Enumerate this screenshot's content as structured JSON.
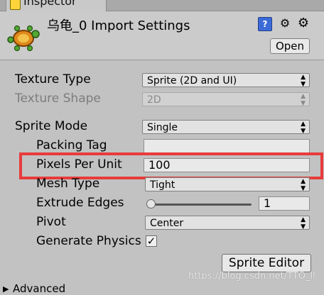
{
  "tab": {
    "label": "Inspector",
    "icon": "inspector-icon"
  },
  "header": {
    "title": "乌龟_0 Import Settings",
    "open_label": "Open",
    "help_icon": "?",
    "preset_icon": "⚙",
    "gear_icon": "⚙"
  },
  "fields": {
    "texture_type": {
      "label": "Texture Type",
      "value": "Sprite (2D and UI)"
    },
    "texture_shape": {
      "label": "Texture Shape",
      "value": "2D"
    },
    "sprite_mode": {
      "label": "Sprite Mode",
      "value": "Single"
    },
    "packing_tag": {
      "label": "Packing Tag",
      "value": ""
    },
    "pixels_per_unit": {
      "label": "Pixels Per Unit",
      "value": "100"
    },
    "mesh_type": {
      "label": "Mesh Type",
      "value": "Tight"
    },
    "extrude_edges": {
      "label": "Extrude Edges",
      "value": "1",
      "slider_fraction": 0.03
    },
    "pivot": {
      "label": "Pivot",
      "value": "Center"
    },
    "generate_physics": {
      "label": "Generate Physics",
      "checked": true,
      "check_glyph": "✓"
    }
  },
  "buttons": {
    "sprite_editor": "Sprite Editor"
  },
  "watermark": "https://blog.csdn.net/TTO_ll",
  "bottom": {
    "advanced_label": "Advanced",
    "arrow_glyph": "▶"
  }
}
